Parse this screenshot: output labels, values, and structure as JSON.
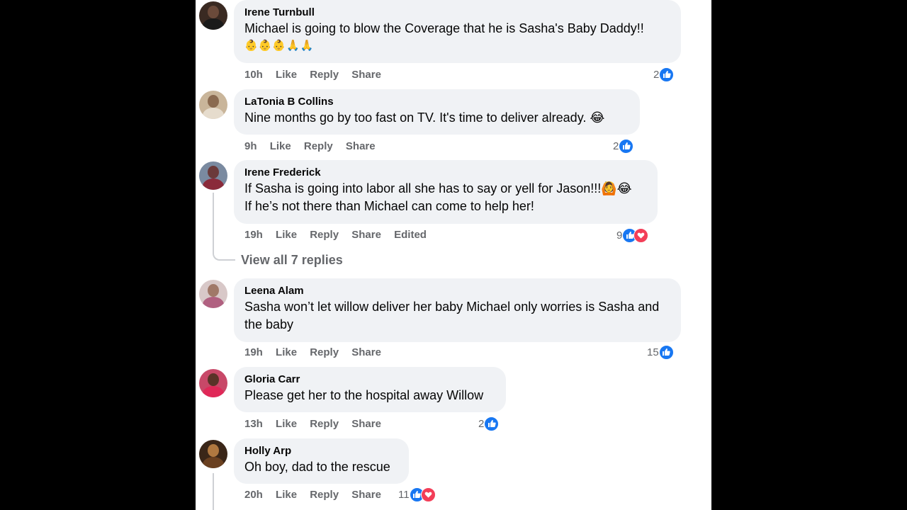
{
  "comments": [
    {
      "name": "Irene Turnbull",
      "text": "Michael is going to blow the Coverage that he is Sasha's Baby Daddy!!",
      "emojis": "👶👶👶🙏🙏",
      "time": "10h",
      "like": "Like",
      "reply": "Reply",
      "share": "Share",
      "reaction_count": "2"
    },
    {
      "name": "LaTonia B Collins",
      "text": "Nine months go by too fast on TV. It's time to deliver already. 😂",
      "time": "9h",
      "like": "Like",
      "reply": "Reply",
      "share": "Share",
      "reaction_count": "2"
    },
    {
      "name": "Irene Frederick",
      "text1": "If Sasha is going into labor all she has to say or yell for Jason!!!🙆😂",
      "text2": "If he’s not there than Michael can come to help her!",
      "time": "19h",
      "like": "Like",
      "reply": "Reply",
      "share": "Share",
      "edited": "Edited",
      "reaction_count": "9"
    },
    {
      "name": "Leena Alam",
      "text": "Sasha won’t let willow deliver her baby Michael only worries is Sasha and the baby",
      "time": "19h",
      "like": "Like",
      "reply": "Reply",
      "share": "Share",
      "reaction_count": "15"
    },
    {
      "name": "Gloria Carr",
      "text": "Please get her to the hospital away Willow",
      "time": "13h",
      "like": "Like",
      "reply": "Reply",
      "share": "Share",
      "reaction_count": "2"
    },
    {
      "name": "Holly Arp",
      "text": "Oh boy, dad to the rescue",
      "time": "20h",
      "like": "Like",
      "reply": "Reply",
      "share": "Share",
      "reaction_count": "11"
    }
  ],
  "view_replies": "View all 7 replies",
  "colors": {
    "like_blue": "#1877f2",
    "love_red": "#f33e58",
    "bubble": "#f0f2f5",
    "meta_gray": "#65676b"
  }
}
